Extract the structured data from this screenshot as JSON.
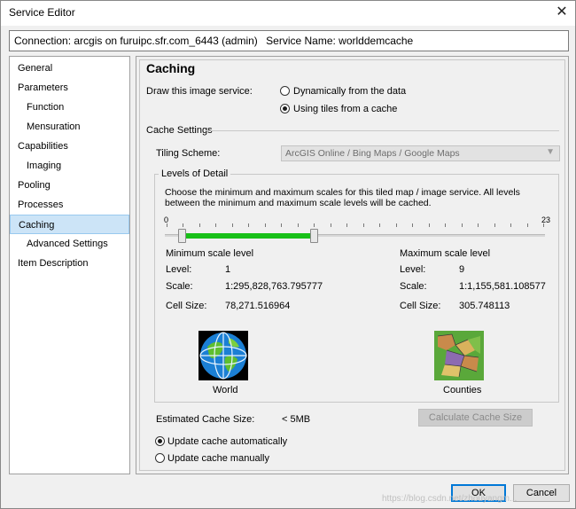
{
  "window": {
    "title": "Service Editor",
    "close_glyph": "✕"
  },
  "connection": {
    "text": "Connection: arcgis on furuipc.sfr.com_6443 (admin)",
    "service": "Service Name: worlddemcache"
  },
  "sidebar": {
    "items": [
      {
        "label": "General",
        "sub": false,
        "selected": false
      },
      {
        "label": "Parameters",
        "sub": false,
        "selected": false
      },
      {
        "label": "Function",
        "sub": true,
        "selected": false
      },
      {
        "label": "Mensuration",
        "sub": true,
        "selected": false
      },
      {
        "label": "Capabilities",
        "sub": false,
        "selected": false
      },
      {
        "label": "Imaging",
        "sub": true,
        "selected": false
      },
      {
        "label": "Pooling",
        "sub": false,
        "selected": false
      },
      {
        "label": "Processes",
        "sub": false,
        "selected": false
      },
      {
        "label": "Caching",
        "sub": false,
        "selected": true
      },
      {
        "label": "Advanced Settings",
        "sub": true,
        "selected": false
      },
      {
        "label": "Item Description",
        "sub": false,
        "selected": false
      }
    ]
  },
  "main": {
    "heading": "Caching",
    "draw_label": "Draw this image service:",
    "radio_dynamic": "Dynamically from the data",
    "radio_tiles": "Using tiles from a cache",
    "draw_selected": "tiles",
    "cache_settings": "Cache Settings",
    "tiling_label": "Tiling Scheme:",
    "tiling_value": "ArcGIS Online / Bing Maps / Google Maps",
    "lod_label": "Levels of Detail",
    "lod_desc": "Choose the minimum and maximum scales for this tiled map / image service. All levels between the minimum and maximum scale levels will be cached.",
    "slider": {
      "min": 0,
      "max": 23,
      "low": 1,
      "high": 9,
      "min_label": "0",
      "max_label": "23",
      "range_color": "#18c018"
    },
    "min_level": {
      "title": "Minimum scale level",
      "level_label": "Level:",
      "level": "1",
      "scale_label": "Scale:",
      "scale": "1:295,828,763.795777",
      "cell_label": "Cell Size:",
      "cell": "78,271.516964",
      "preview": "World",
      "icon": "globe-icon"
    },
    "max_level": {
      "title": "Maximum scale level",
      "level_label": "Level:",
      "level": "9",
      "scale_label": "Scale:",
      "scale": "1:1,155,581.108577",
      "cell_label": "Cell Size:",
      "cell": "305.748113",
      "preview": "Counties",
      "icon": "counties-map-icon"
    },
    "est_label": "Estimated Cache Size:",
    "est_value": "< 5MB",
    "calc_button": "Calculate Cache Size",
    "radio_auto": "Update cache automatically",
    "radio_manual": "Update cache manually",
    "update_selected": "auto"
  },
  "footer": {
    "ok": "OK",
    "cancel": "Cancel",
    "watermark": "https://blog.csdn.net/zhouyangm..."
  },
  "colors": {
    "selection": "#cce4f7",
    "accent": "#0078d7"
  }
}
